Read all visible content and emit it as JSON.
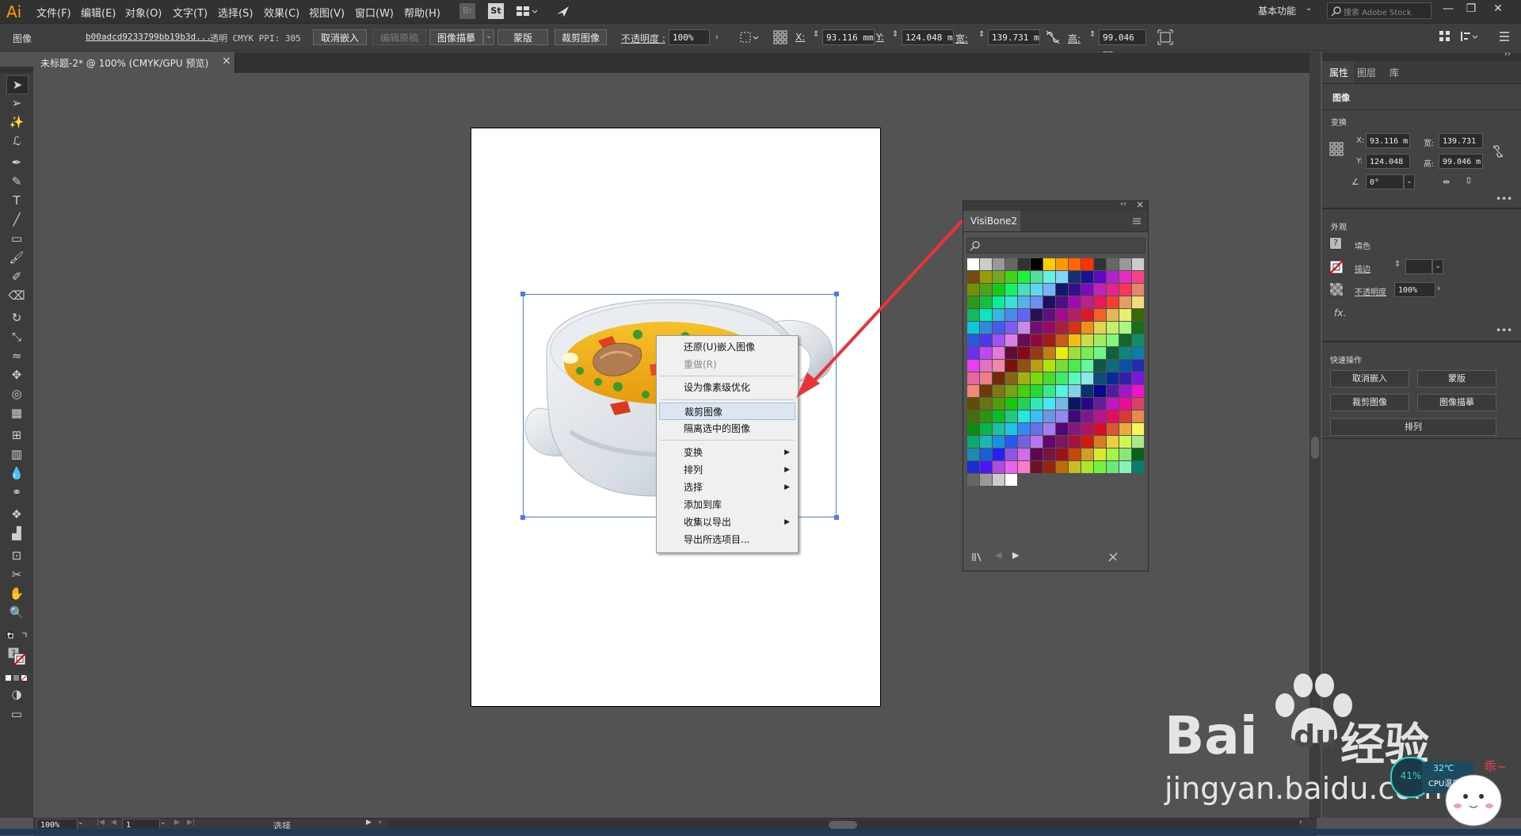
{
  "app": {
    "logo": "Ai"
  },
  "menubar": {
    "items": [
      "文件(F)",
      "编辑(E)",
      "对象(O)",
      "文字(T)",
      "选择(S)",
      "效果(C)",
      "视图(V)",
      "窗口(W)",
      "帮助(H)"
    ],
    "br_icon": "Br",
    "st_icon": "St",
    "workspace": "基本功能",
    "search_placeholder": "搜索 Adobe Stock"
  },
  "controlbar": {
    "object_type": "图像",
    "filename": "b00adcd9233799bb19b3d...",
    "info": "透明  CMYK  PPI: 305",
    "unembed": "取消嵌入",
    "edit_original": "编辑原稿",
    "image_trace": "图像描摹",
    "mask": "蒙版",
    "crop": "裁剪图像",
    "opacity_label": "不透明度 :",
    "opacity": "100%",
    "x_label": "X:",
    "x": "93.116 mm",
    "y_label": "Y:",
    "y": "124.048 m",
    "w_label": "宽:",
    "w": "139.731 m",
    "h_label": "高:",
    "h": "99.046 mm"
  },
  "document_tab": {
    "title": "未标题-2* @ 100% (CMYK/GPU 预览)",
    "close": "×"
  },
  "context_menu": {
    "items": [
      {
        "label": "还原(U)嵌入图像",
        "disabled": false,
        "submenu": false
      },
      {
        "label": "重做(R)",
        "disabled": true,
        "submenu": false
      },
      {
        "label": "设为像素级优化",
        "disabled": false,
        "submenu": false
      },
      {
        "label": "裁剪图像",
        "disabled": false,
        "submenu": false,
        "highlighted": true
      },
      {
        "label": "隔离选中的图像",
        "disabled": false,
        "submenu": false
      },
      {
        "label": "变换",
        "disabled": false,
        "submenu": true
      },
      {
        "label": "排列",
        "disabled": false,
        "submenu": true
      },
      {
        "label": "选择",
        "disabled": false,
        "submenu": true
      },
      {
        "label": "添加到库",
        "disabled": false,
        "submenu": false
      },
      {
        "label": "收集以导出",
        "disabled": false,
        "submenu": true
      },
      {
        "label": "导出所选项目...",
        "disabled": false,
        "submenu": false
      }
    ]
  },
  "swatch_panel": {
    "title": "VisiBone2",
    "collapse": "‹‹",
    "close": "×"
  },
  "right_panel": {
    "tabs": [
      "属性",
      "图层",
      "库"
    ],
    "object_type": "图像",
    "transform_title": "变换",
    "x_label": "X:",
    "x": "93.116 m",
    "y_label": "Y:",
    "y": "124.048",
    "w_label": "宽:",
    "w": "139.731",
    "h_label": "高:",
    "h": "99.046 m",
    "angle": "0°",
    "appearance_title": "外观",
    "fill_label": "填色",
    "stroke_label": "描边",
    "opacity_label": "不透明度",
    "opacity": "100%",
    "fx": "fx.",
    "quick_actions_title": "快速操作",
    "qa_unembed": "取消嵌入",
    "qa_mask": "蒙版",
    "qa_crop": "裁剪图像",
    "qa_trace": "图像描摹",
    "qa_arrange": "排列"
  },
  "statusbar": {
    "zoom": "100%",
    "page": "1",
    "mode": "选择"
  },
  "watermark": {
    "brand": "Bai",
    "brand2": "du",
    "jingyan": "经验",
    "url": "jingyan.baidu.com",
    "temp": "32℃",
    "cpu_label": "CPU温度",
    "percent": "41%"
  },
  "colors": {
    "accent_orange": "#ff9a00",
    "selection_blue": "#4a7ef0",
    "arrow_red": "#e8343a"
  }
}
